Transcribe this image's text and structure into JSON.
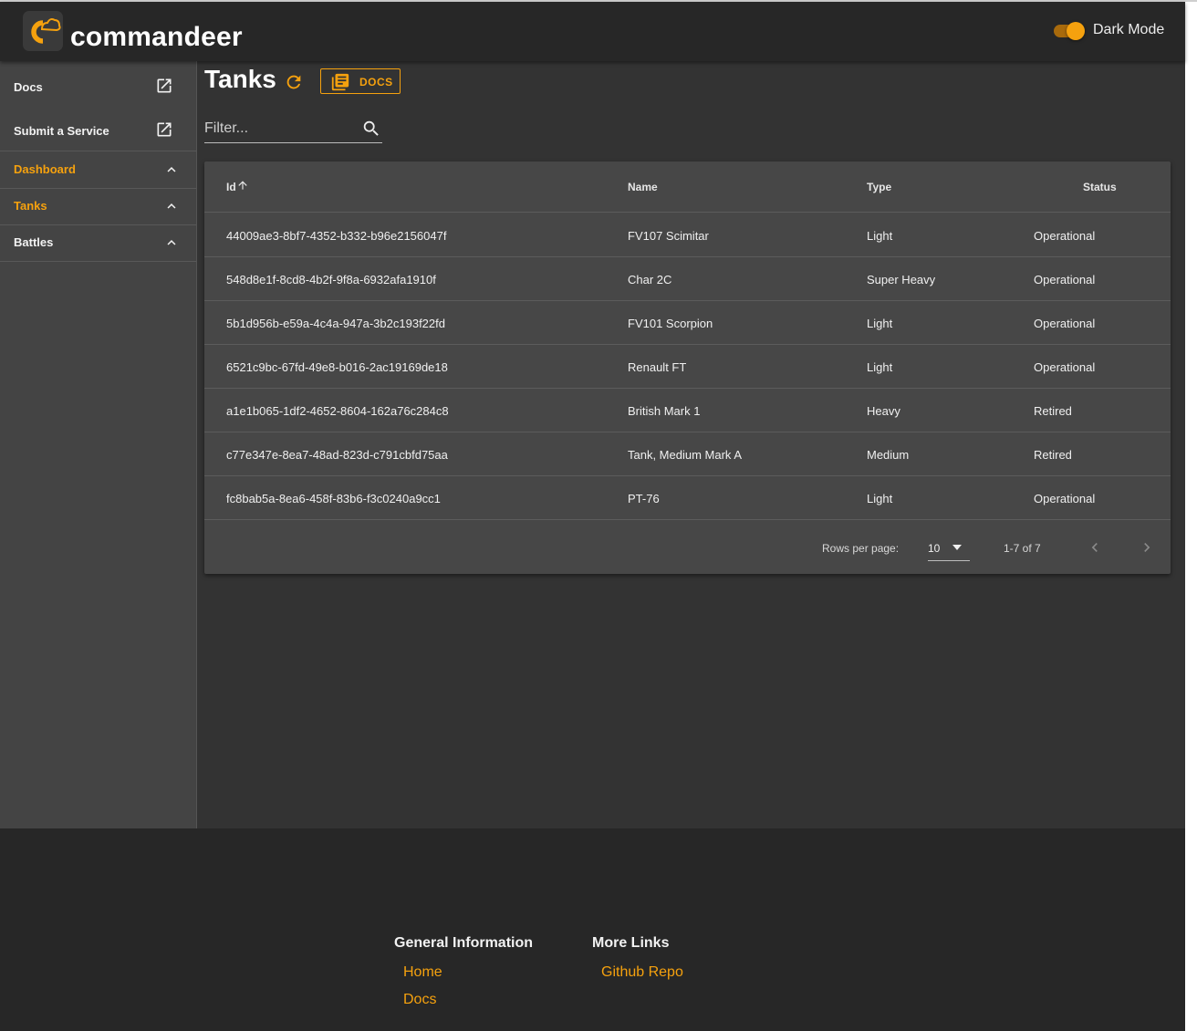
{
  "app": {
    "brand": "commandeer",
    "dark_mode_label": "Dark Mode",
    "dark_mode_on": true,
    "accent": "#f5a10e"
  },
  "sidebar": {
    "links": [
      {
        "label": "Docs",
        "icon": "open-in-new-icon"
      },
      {
        "label": "Submit a Service",
        "icon": "open-in-new-icon"
      }
    ],
    "sections": [
      {
        "label": "Dashboard",
        "active": true,
        "icon": "chevron-up-icon"
      },
      {
        "label": "Tanks",
        "active": true,
        "icon": "chevron-up-icon"
      },
      {
        "label": "Battles",
        "active": false,
        "icon": "chevron-up-icon"
      }
    ]
  },
  "page": {
    "title": "Tanks",
    "docs_button": "DOCS",
    "refresh_icon": "refresh-icon",
    "docs_icon": "library-books-icon"
  },
  "filter": {
    "placeholder": "Filter...",
    "value": "",
    "icon": "search-icon"
  },
  "table": {
    "columns": {
      "id": "Id",
      "name": "Name",
      "type": "Type",
      "status": "Status"
    },
    "sort": {
      "column": "Id",
      "direction": "ascending",
      "icon": "arrow-up-icon"
    },
    "rows": [
      {
        "id": "44009ae3-8bf7-4352-b332-b96e2156047f",
        "name": "FV107 Scimitar",
        "type": "Light",
        "status": "Operational"
      },
      {
        "id": "548d8e1f-8cd8-4b2f-9f8a-6932afa1910f",
        "name": "Char 2C",
        "type": "Super Heavy",
        "status": "Operational"
      },
      {
        "id": "5b1d956b-e59a-4c4a-947a-3b2c193f22fd",
        "name": "FV101 Scorpion",
        "type": "Light",
        "status": "Operational"
      },
      {
        "id": "6521c9bc-67fd-49e8-b016-2ac19169de18",
        "name": "Renault FT",
        "type": "Light",
        "status": "Operational"
      },
      {
        "id": "a1e1b065-1df2-4652-8604-162a76c284c8",
        "name": "British Mark 1",
        "type": "Heavy",
        "status": "Retired"
      },
      {
        "id": "c77e347e-8ea7-48ad-823d-c791cbfd75aa",
        "name": "Tank, Medium Mark A",
        "type": "Medium",
        "status": "Retired"
      },
      {
        "id": "fc8bab5a-8ea6-458f-83b6-f3c0240a9cc1",
        "name": "PT-76",
        "type": "Light",
        "status": "Operational"
      }
    ],
    "pagination": {
      "rows_per_page_label": "Rows per page:",
      "rows_per_page": "10",
      "range": "1-7 of 7"
    }
  },
  "footer": {
    "columns": [
      {
        "title": "General Information",
        "links": [
          "Home",
          "Docs"
        ]
      },
      {
        "title": "More Links",
        "links": [
          "Github Repo"
        ]
      }
    ]
  }
}
